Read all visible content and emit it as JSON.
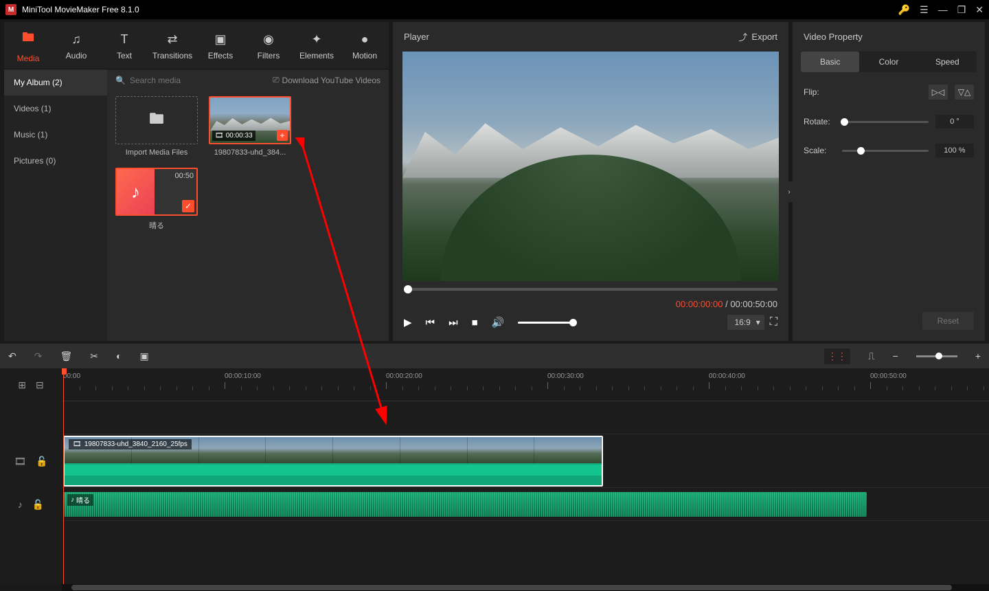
{
  "app": {
    "title": "MiniTool MovieMaker Free 8.1.0"
  },
  "tabs": {
    "media": "Media",
    "audio": "Audio",
    "text": "Text",
    "transitions": "Transitions",
    "effects": "Effects",
    "filters": "Filters",
    "elements": "Elements",
    "motion": "Motion"
  },
  "sidebar": {
    "items": [
      {
        "label": "My Album (2)",
        "active": true
      },
      {
        "label": "Videos (1)"
      },
      {
        "label": "Music (1)"
      },
      {
        "label": "Pictures (0)"
      }
    ]
  },
  "media": {
    "search_placeholder": "Search media",
    "download_label": "Download YouTube Videos",
    "items": {
      "import_label": "Import Media Files",
      "video": {
        "name": "19807833-uhd_384...",
        "duration": "00:00:33"
      },
      "music": {
        "name": "晴る",
        "duration": "00:50"
      }
    }
  },
  "player": {
    "title": "Player",
    "export_label": "Export",
    "time_current": "00:00:00:00",
    "time_total": "00:00:50:00",
    "aspect": "16:9"
  },
  "properties": {
    "panel_title": "Video Property",
    "tabs": {
      "basic": "Basic",
      "color": "Color",
      "speed": "Speed"
    },
    "flip_label": "Flip:",
    "rotate_label": "Rotate:",
    "rotate_value": "0 °",
    "scale_label": "Scale:",
    "scale_value": "100 %",
    "reset_label": "Reset"
  },
  "timeline": {
    "ticks": [
      {
        "label": "00:00",
        "pos": 2
      },
      {
        "label": "00:00:10:00",
        "pos": 237
      },
      {
        "label": "00:00:20:00",
        "pos": 472
      },
      {
        "label": "00:00:30:00",
        "pos": 707
      },
      {
        "label": "00:00:40:00",
        "pos": 942
      },
      {
        "label": "00:00:50:00",
        "pos": 1177
      }
    ],
    "video_clip_label": "19807833-uhd_3840_2160_25fps",
    "audio_clip_label": "晴る"
  }
}
